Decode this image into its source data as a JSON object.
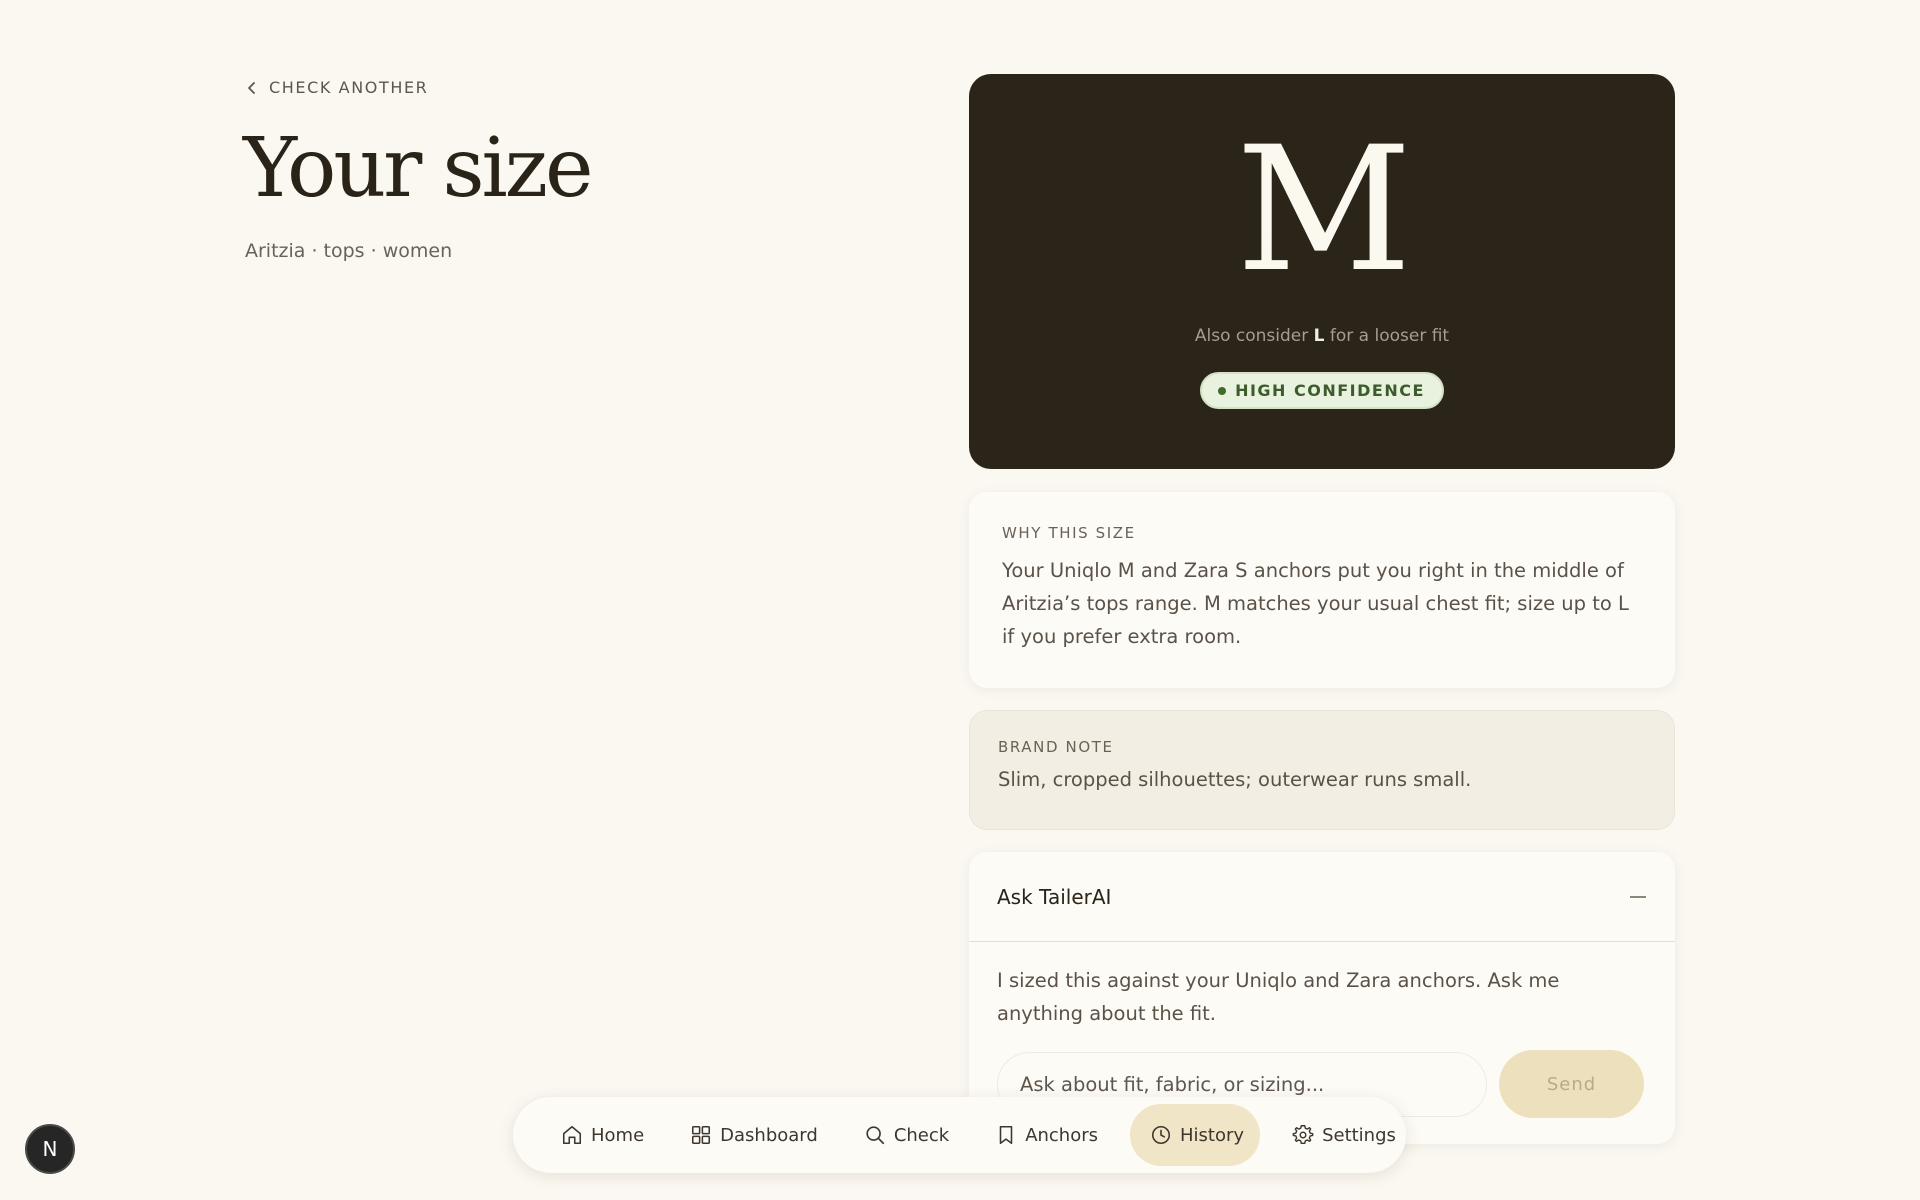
{
  "back_link": {
    "label": "CHECK ANOTHER",
    "icon": "chevron-left-icon"
  },
  "header": {
    "title": "Your size",
    "subtitle": "Aritzia · tops · women"
  },
  "result": {
    "size": "M",
    "consider_prefix": "Also consider",
    "consider_size": "L",
    "consider_suffix": "for a looser fit",
    "confidence": "HIGH CONFIDENCE",
    "confidence_color": "#3f6b2c"
  },
  "why": {
    "label": "WHY THIS SIZE",
    "text": "Your Uniqlo M and Zara S anchors put you right in the middle of Aritzia’s tops range. M matches your usual chest fit; size up to L if you prefer extra room."
  },
  "brand_note": {
    "label": "BRAND NOTE",
    "text": "Slim, cropped silhouettes; outerwear runs small."
  },
  "ask": {
    "title": "Ask TailerAI",
    "message": "I sized this against your Uniqlo and Zara anchors. Ask me anything about the fit.",
    "input_value": "",
    "input_placeholder": "Ask about fit, fabric, or sizing...",
    "send_label": "Send"
  },
  "nav": {
    "items": [
      {
        "label": "Home",
        "icon": "home-icon",
        "active": false
      },
      {
        "label": "Dashboard",
        "icon": "grid-icon",
        "active": false
      },
      {
        "label": "Check",
        "icon": "search-icon",
        "active": false
      },
      {
        "label": "Anchors",
        "icon": "bookmark-icon",
        "active": false
      },
      {
        "label": "History",
        "icon": "clock-icon",
        "active": true
      },
      {
        "label": "Settings",
        "icon": "gear-icon",
        "active": false
      }
    ]
  },
  "dev_badge": {
    "label": "N"
  },
  "colors": {
    "background": "#fbf8f2",
    "dark_card": "#2a2419",
    "accent": "#f0e5c6",
    "send_button": "#ede1bd"
  }
}
